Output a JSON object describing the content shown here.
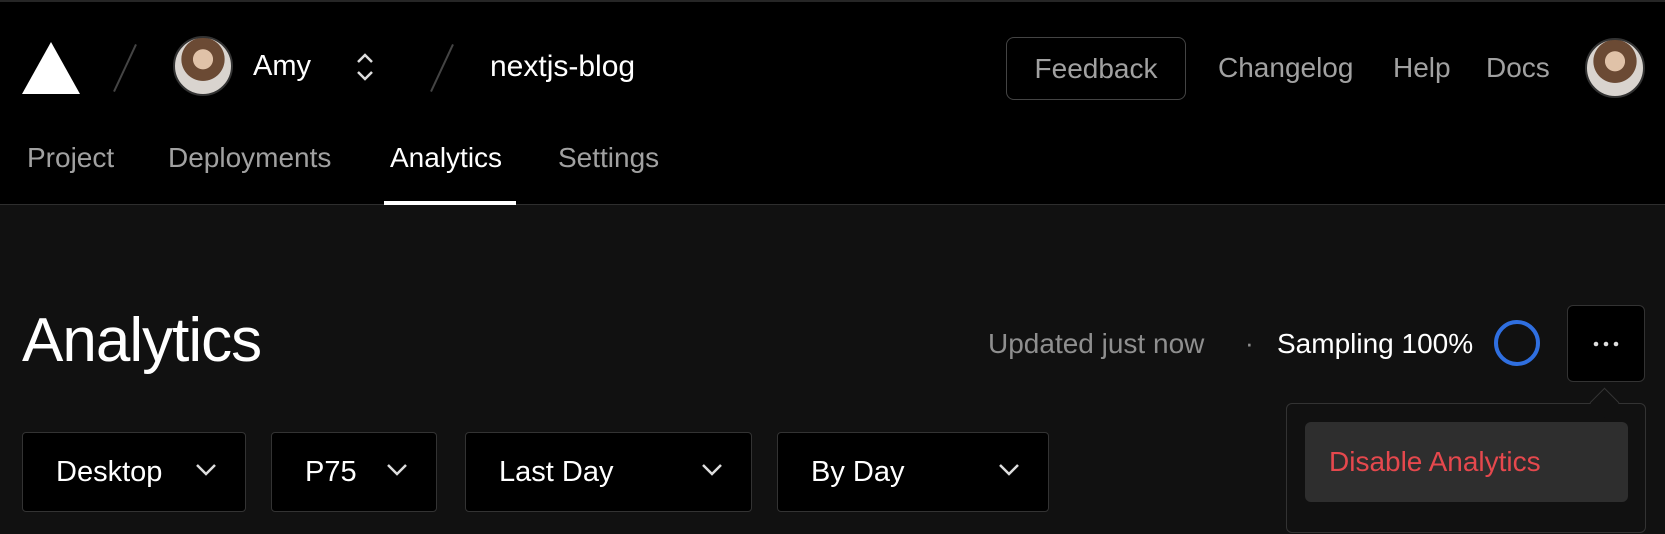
{
  "header": {
    "team": {
      "name": "Amy"
    },
    "project": {
      "name": "nextjs-blog"
    },
    "feedback_label": "Feedback",
    "links": [
      "Changelog",
      "Help",
      "Docs"
    ]
  },
  "tabs": [
    {
      "label": "Project",
      "active": false
    },
    {
      "label": "Deployments",
      "active": false
    },
    {
      "label": "Analytics",
      "active": true
    },
    {
      "label": "Settings",
      "active": false
    }
  ],
  "page": {
    "title": "Analytics",
    "updated": "Updated just now",
    "separator": "·",
    "sampling": "Sampling 100%"
  },
  "menu": {
    "items": [
      {
        "label": "Disable Analytics",
        "color": "#e5484d"
      }
    ]
  },
  "filters": [
    {
      "value": "Desktop"
    },
    {
      "value": "P75"
    },
    {
      "value": "Last Day"
    },
    {
      "value": "By Day"
    }
  ],
  "colors": {
    "accent_ring": "#2f6fe0",
    "danger": "#e5484d"
  },
  "icons": {
    "logo": "vercel-triangle-icon",
    "switcher": "chevron-up-down-icon",
    "more": "ellipsis-icon",
    "select": "chevron-down-icon"
  }
}
